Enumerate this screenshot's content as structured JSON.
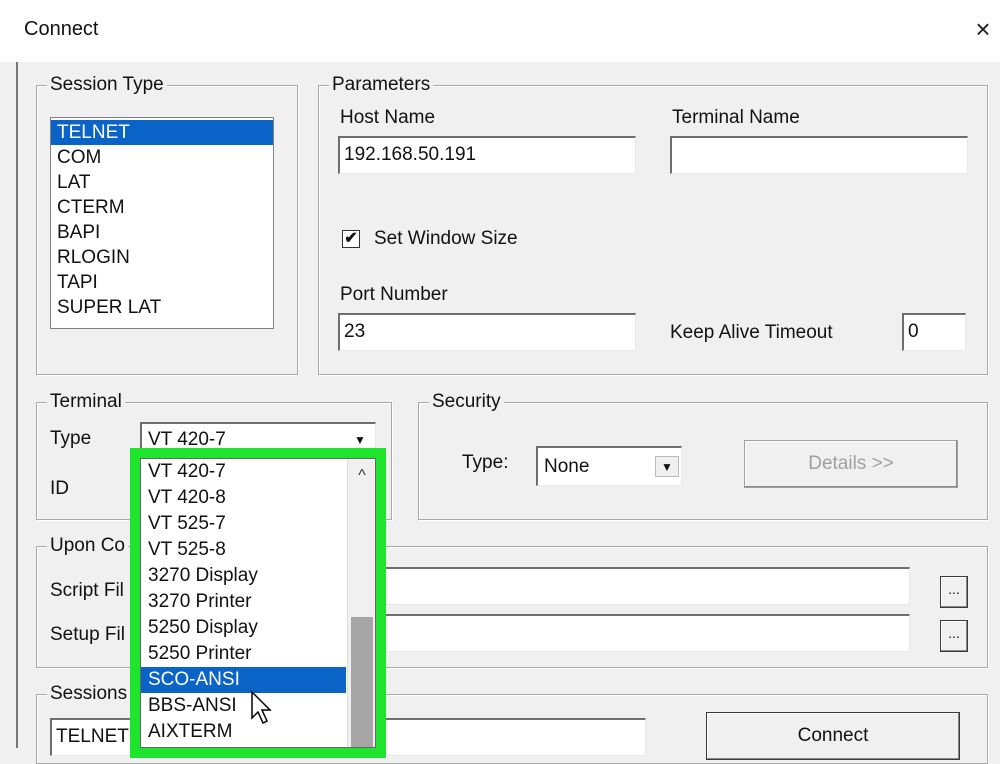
{
  "window": {
    "title": "Connect",
    "close": "×"
  },
  "session_type": {
    "legend": "Session Type",
    "items": [
      "TELNET",
      "COM",
      "LAT",
      "CTERM",
      "BAPI",
      "RLOGIN",
      "TAPI",
      "SUPER LAT"
    ],
    "selected": "TELNET"
  },
  "parameters": {
    "legend": "Parameters",
    "host_label": "Host Name",
    "host_value": "192.168.50.191",
    "terminal_name_label": "Terminal Name",
    "terminal_name_value": "",
    "set_window_size_label": "Set Window Size",
    "set_window_size_checked": "✔",
    "port_label": "Port Number",
    "port_value": "23",
    "keepalive_label": "Keep Alive Timeout",
    "keepalive_value": "0"
  },
  "terminal": {
    "legend": "Terminal",
    "type_label": "Type",
    "type_value": "VT 420-7",
    "id_label": "ID",
    "dropdown_arrow": "▼",
    "options": [
      "VT 420-7",
      "VT 420-8",
      "VT 525-7",
      "VT 525-8",
      "3270 Display",
      "3270 Printer",
      "5250 Display",
      "5250 Printer",
      "SCO-ANSI",
      "BBS-ANSI",
      "AIXTERM"
    ],
    "hovered": "SCO-ANSI",
    "scroll_up": "^"
  },
  "security": {
    "legend": "Security",
    "type_label": "Type:",
    "type_value": "None",
    "details_label": "Details >>"
  },
  "upon_connect": {
    "legend": "Upon Co",
    "script_label": "Script Fil",
    "setup_label": "Setup Fil",
    "browse_label": "..."
  },
  "sessions": {
    "legend": "Sessions",
    "value": "TELNET",
    "connect_label": "Connect"
  }
}
